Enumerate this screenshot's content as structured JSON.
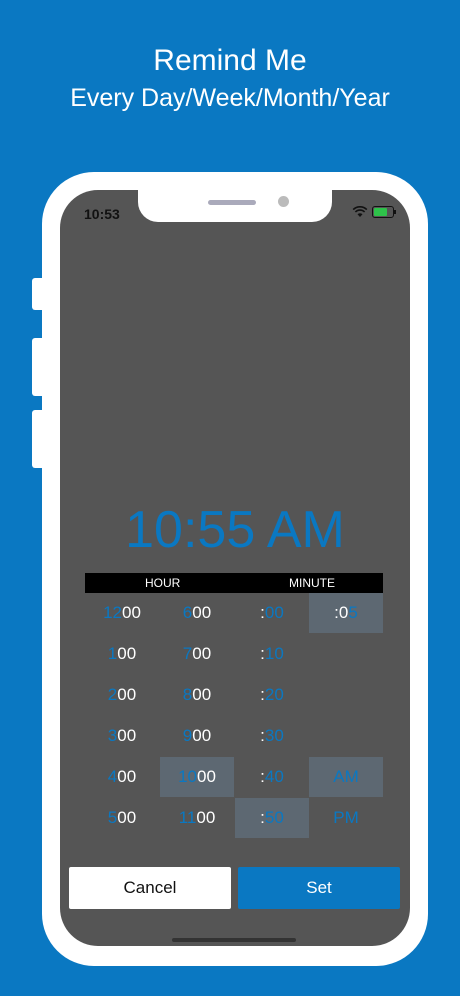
{
  "headline": {
    "line1": "Remind Me",
    "line2": "Every Day/Week/Month/Year"
  },
  "status_bar": {
    "time": "10:53",
    "icons": [
      "wifi-icon",
      "battery-charging-icon"
    ]
  },
  "time_display": "10:55 AM",
  "picker": {
    "hour_label": "HOUR",
    "minute_label": "MINUTE",
    "hours_col1": [
      {
        "num": "12",
        "suffix": "00"
      },
      {
        "num": "1",
        "suffix": "00"
      },
      {
        "num": "2",
        "suffix": "00"
      },
      {
        "num": "3",
        "suffix": "00"
      },
      {
        "num": "4",
        "suffix": "00"
      },
      {
        "num": "5",
        "suffix": "00"
      }
    ],
    "hours_col2": [
      {
        "num": "6",
        "suffix": "00"
      },
      {
        "num": "7",
        "suffix": "00"
      },
      {
        "num": "8",
        "suffix": "00"
      },
      {
        "num": "9",
        "suffix": "00"
      },
      {
        "num": "10",
        "suffix": "00"
      },
      {
        "num": "11",
        "suffix": "00"
      }
    ],
    "minutes_tens": [
      {
        "prefix": ":",
        "val": "00"
      },
      {
        "prefix": ":",
        "val": "10"
      },
      {
        "prefix": ":",
        "val": "20"
      },
      {
        "prefix": ":",
        "val": "30"
      },
      {
        "prefix": ":",
        "val": "40"
      },
      {
        "prefix": ":",
        "val": "50"
      }
    ],
    "minutes_ones": {
      "prefix": ":0",
      "val": "5"
    },
    "ampm": [
      "AM",
      "PM"
    ],
    "selected": {
      "hour": "10",
      "minute_tens": "50",
      "minute_ones": "5",
      "ampm": "AM"
    }
  },
  "buttons": {
    "cancel": "Cancel",
    "set": "Set"
  },
  "colors": {
    "background": "#0a78c2",
    "screen": "#555555",
    "accent": "#0a78c2",
    "selected_cell": "#5d6872"
  }
}
